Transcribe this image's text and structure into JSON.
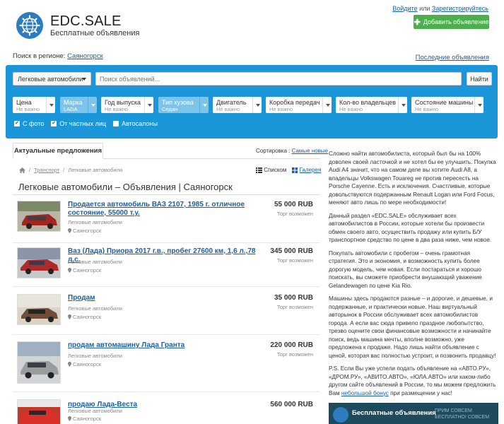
{
  "header": {
    "brand": "EDC.SALE",
    "tagline": "Бесплатные объявления",
    "login": "Войдите",
    "or": " или ",
    "register": "Зарегистрируйтесь",
    "add_button": "Добавить объявление"
  },
  "region": {
    "label": "Поиск в регионе: ",
    "city": "Саяногорск",
    "latest": "Последние объявления"
  },
  "search": {
    "category": "Легковые автомобили",
    "placeholder": "Поиск объявлений...",
    "button": "Найти"
  },
  "filters": [
    {
      "label": "Цена",
      "value": "Не важно"
    },
    {
      "label": "Марка",
      "value": "LADA"
    },
    {
      "label": "Год выпуска",
      "value": "Не важно"
    },
    {
      "label": "Тип кузова",
      "value": "Седан"
    },
    {
      "label": "Двигатель",
      "value": "Не важно"
    },
    {
      "label": "Коробка передач",
      "value": "Не важно"
    },
    {
      "label": "Кол-во владельцев",
      "value": "Не важно"
    },
    {
      "label": "Состояние машины",
      "value": "Не важно"
    }
  ],
  "checks": [
    {
      "label": "С фото",
      "checked": true
    },
    {
      "label": "От частных лиц",
      "checked": true
    },
    {
      "label": "Автосалоны",
      "checked": false
    }
  ],
  "tabs": {
    "active": "Актуальные предложения",
    "sort_label": "Сортировка : ",
    "sort_value": "Самые новые"
  },
  "breadcrumb": {
    "transport": "Транспорт",
    "current": "Легковые автомобили",
    "list_view": "Списком",
    "gallery_view": "Галерея"
  },
  "page_title": "Легковые автомобили – Объявления | Саяногорск",
  "listings": [
    {
      "title": "Продается автомобиль ВАЗ 2107, 1985 г. отличное состояние, 55000 т.у.",
      "category": "Легковые автомобили",
      "location": "Саяногорск",
      "price": "55 000 RUB",
      "negotiable": "Торг возможен"
    },
    {
      "title": "Ваз (Лада) Приора 2017 г.в., пробег 27600 км, 1,6 л.,78 л.с.",
      "category": "Легковые автомобили",
      "location": "Саяногорск",
      "price": "345 000 RUB",
      "negotiable": "Торг возможен"
    },
    {
      "title": "Продам",
      "category": "Легковые автомобили",
      "location": "Саяногорск",
      "price": "35 000 RUB",
      "negotiable": "Торг возможен"
    },
    {
      "title": "продам автомашину Лада Гранта",
      "category": "Легковые автомобили",
      "location": "Саяногорск",
      "price": "220 000 RUB",
      "negotiable": "Торг возможен"
    },
    {
      "title": "продаю Лада-Веста",
      "category": "Легковые автомобили",
      "location": "Саяногорск",
      "price": "560 000 RUB",
      "negotiable": ""
    }
  ],
  "seo": {
    "p1": "Сложно найти автомобилиста, который был бы на 100% доволен своей ласточкой и не хотел бы ее улучшить. Покупка Audi A4 значит, что на самом деле вы хотите Audi A8, а владельцы Volkswagen Touareg не против пересесть на Porsche Cayenne. Есть и исключения. Счастливые, которые довольствуются подержанным Renault Logan или Ford Focus, меняют авто лишь по мере необходимости!",
    "p2": "Данный раздел «EDC.SALE» обслуживает всех автомобилистов в России, которые хотели бы произвести обмен своего авто, осуществить продажу или купить Б/У транспортное средство по цене в два раза ниже, чем новое.",
    "p3": "Покупать автомобили с пробегом – очень грамотная стратегия. Это и экономия, и возможность купить более дорогую модель, чем новая. Если постараться и хорошо поискать, вы сможете приобрести внушающий уважение Gelandewagen по цене Kia Rio.",
    "p4": "Машины здесь продаются разные – и дорогие, и дешевые, и подержанные, и практически новые. Наш виртуальный авторынок в России обслуживает всех автомобилистов города. А если вас сюда привело праздное любопытство, трезво оцените свои финансовые возможности и начинайте поиск, ведь машина мечты, вполне возможно, уже предложена к продаже. Надо лишь найти объявление с ценой, которая вас полностью устроит, и позвонить продавцу!",
    "p5_start": "P.S. Если Вы уже успели подать объявление на «АВТО.РУ», «ДРОМ.РУ», «АВИТО.АВТО», «ЮЛА.АВТО» или каком-либо другом сайте объявлений в России, то мы можем предложить Вам ",
    "p5_link": "небольшой бонус",
    "p5_end": " при размещении у нас!"
  },
  "banner": {
    "title": "Бесплатные объявления",
    "subtitle": "ПРИМ СОВСЕМ БЕСПЛАТНО! СОВСЕМ"
  }
}
